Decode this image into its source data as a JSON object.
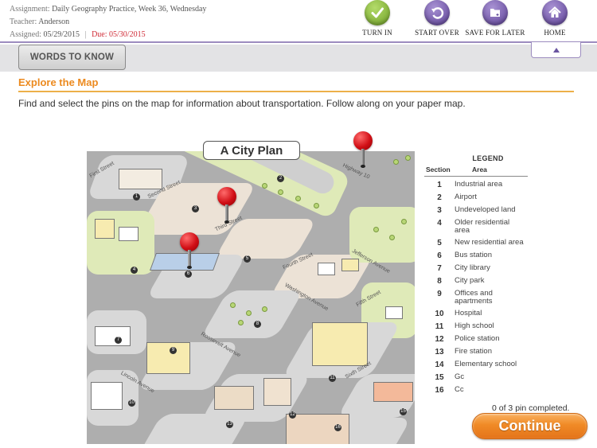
{
  "header": {
    "assignment_label": "Assignment:",
    "assignment_value": "Daily Geography Practice, Week 36, Wednesday",
    "teacher_label": "Teacher:",
    "teacher_value": "Anderson",
    "assigned_label": "Assigned:",
    "assigned_value": "05/29/2015",
    "separator": "|",
    "due_label": "Due:",
    "due_value": "05/30/2015"
  },
  "toolbar": {
    "turn_in": "TURN IN",
    "start_over": "START OVER",
    "save_for_later": "SAVE FOR LATER",
    "home": "HOME"
  },
  "words_to_know": "WORDS TO KNOW",
  "section": {
    "title": "Explore the Map",
    "instructions": "Find and select the pins on the map for information about transportation. Follow along on your paper map."
  },
  "map": {
    "title": "A City Plan",
    "streets": {
      "first": "First Street",
      "second": "Second Street",
      "third": "Third Street",
      "fourth": "Fourth Street",
      "fifth": "Fifth Street",
      "sixth": "Sixth Street",
      "highway": "Highway 10",
      "jefferson": "Jefferson Avenue",
      "washington": "Washington Avenue",
      "roosevelt": "Roosevelt Avenue",
      "lincoln": "Lincoln Avenue"
    },
    "section_numbers": [
      "1",
      "2",
      "3",
      "4",
      "5",
      "6",
      "7",
      "8",
      "9",
      "10",
      "11",
      "12",
      "13",
      "14",
      "15",
      "16"
    ],
    "highway_sign": "10",
    "pins_total": 3
  },
  "legend": {
    "title": "LEGEND",
    "col_section": "Section",
    "col_area": "Area",
    "rows": [
      {
        "n": "1",
        "area": "Industrial area"
      },
      {
        "n": "2",
        "area": "Airport"
      },
      {
        "n": "3",
        "area": "Undeveloped land"
      },
      {
        "n": "4",
        "area": "Older residential area"
      },
      {
        "n": "5",
        "area": "New residential area"
      },
      {
        "n": "6",
        "area": "Bus station"
      },
      {
        "n": "7",
        "area": "City library"
      },
      {
        "n": "8",
        "area": "City park"
      },
      {
        "n": "9",
        "area": "Offices and apartments"
      },
      {
        "n": "10",
        "area": "Hospital"
      },
      {
        "n": "11",
        "area": "High school"
      },
      {
        "n": "12",
        "area": "Police station"
      },
      {
        "n": "13",
        "area": "Fire station"
      },
      {
        "n": "14",
        "area": "Elementary school"
      },
      {
        "n": "15",
        "area": "Gc"
      },
      {
        "n": "16",
        "area": "Cc"
      }
    ]
  },
  "progress": "0 of 3 pin completed.",
  "continue_label": "Continue",
  "colors": {
    "accent_orange": "#ec8a1f",
    "purple": "#6a55a0",
    "due_red": "#d02b36",
    "turn_in_green": "#8bbd3a"
  }
}
